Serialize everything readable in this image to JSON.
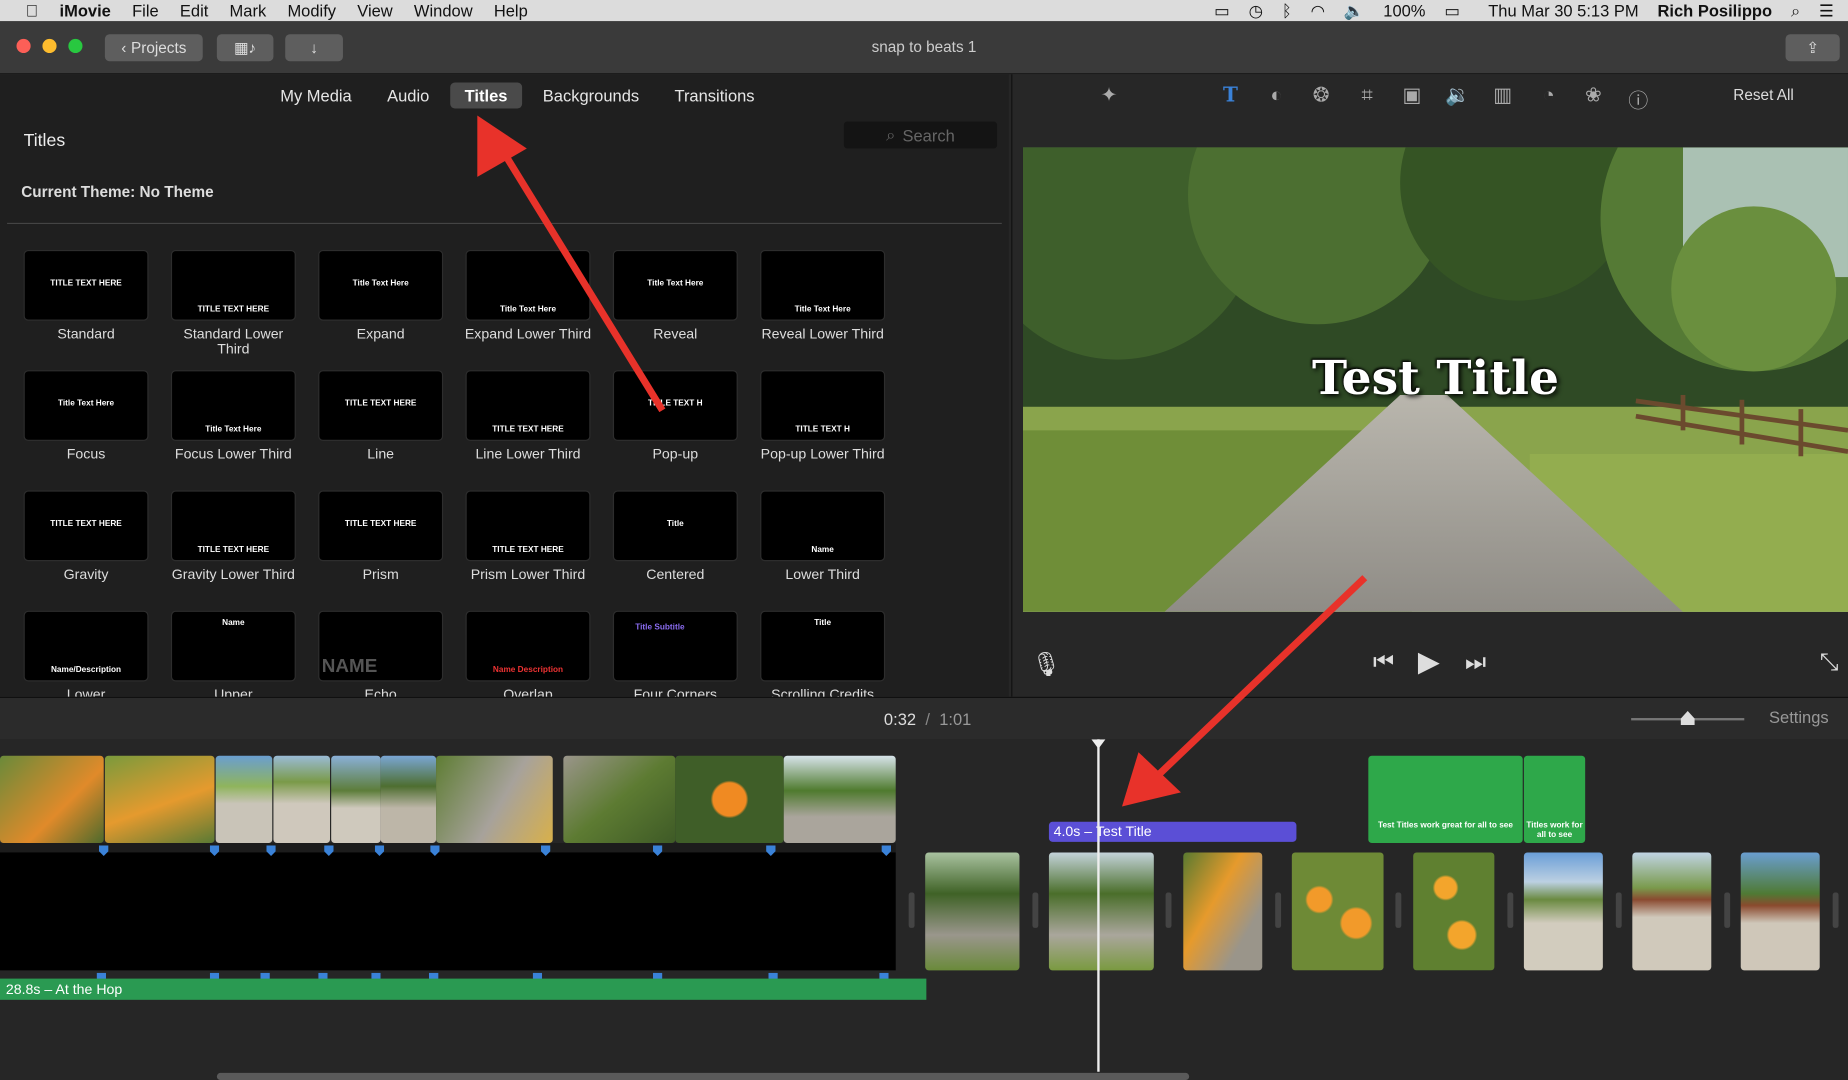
{
  "menubar": {
    "app": "iMovie",
    "menus": [
      "File",
      "Edit",
      "Mark",
      "Modify",
      "View",
      "Window",
      "Help"
    ],
    "battery": "100%",
    "datetime": "Thu Mar 30  5:13 PM",
    "user": "Rich Posilippo"
  },
  "toolbar": {
    "projects_label": "Projects",
    "document_title": "snap to beats 1"
  },
  "browser": {
    "tabs": [
      "My Media",
      "Audio",
      "Titles",
      "Backgrounds",
      "Transitions"
    ],
    "active_tab": "Titles",
    "library_title": "Titles",
    "search_placeholder": "Search",
    "theme_label": "Current Theme: No Theme",
    "titles": [
      {
        "name": "Standard",
        "thumb": "TITLE TEXT HERE"
      },
      {
        "name": "Standard Lower Third",
        "thumb": "TITLE TEXT HERE"
      },
      {
        "name": "Expand",
        "thumb": "Title Text Here"
      },
      {
        "name": "Expand Lower Third",
        "thumb": "Title Text Here"
      },
      {
        "name": "Reveal",
        "thumb": "Title Text Here"
      },
      {
        "name": "Reveal Lower Third",
        "thumb": "Title Text Here"
      },
      {
        "name": "Focus",
        "thumb": "Title Text Here"
      },
      {
        "name": "Focus Lower Third",
        "thumb": "Title Text Here"
      },
      {
        "name": "Line",
        "thumb": "TITLE TEXT HERE"
      },
      {
        "name": "Line Lower Third",
        "thumb": "TITLE TEXT HERE"
      },
      {
        "name": "Pop-up",
        "thumb": "TITLE TEXT H"
      },
      {
        "name": "Pop-up Lower Third",
        "thumb": "TITLE TEXT H"
      },
      {
        "name": "Gravity",
        "thumb": "TITLE TEXT HERE"
      },
      {
        "name": "Gravity Lower Third",
        "thumb": "TITLE TEXT HERE"
      },
      {
        "name": "Prism",
        "thumb": "TITLE TEXT HERE"
      },
      {
        "name": "Prism Lower Third",
        "thumb": "TITLE TEXT HERE"
      },
      {
        "name": "Centered",
        "thumb": "Title"
      },
      {
        "name": "Lower Third",
        "thumb": "Name"
      },
      {
        "name": "Lower",
        "thumb": "Name/Description"
      },
      {
        "name": "Upper",
        "thumb": "Name"
      },
      {
        "name": "Echo",
        "thumb": "NAME"
      },
      {
        "name": "Overlap",
        "thumb": "Name Description"
      },
      {
        "name": "Four Corners",
        "thumb": "Title Subtitle"
      },
      {
        "name": "Scrolling Credits",
        "thumb": "Title"
      }
    ]
  },
  "viewer": {
    "reset_label": "Reset All",
    "overlay_title": "Test Title"
  },
  "timeline": {
    "current_time": "0:32",
    "separator": "/",
    "total_time": "1:01",
    "settings_label": "Settings",
    "title_clip_label": "4.0s – Test Title",
    "green_clip_1": "Test Titles work great for all to see",
    "green_clip_2": "Titles work for all to see",
    "audio_clip_label": "28.8s – At the Hop",
    "zoom_level": 0.5
  },
  "colors": {
    "accent_blue": "#3a82d8",
    "title_clip": "#5b4fd6",
    "audio_clip": "#2a9a52",
    "green_screen": "#2ea84a",
    "annotation_arrow": "#e8322a"
  }
}
